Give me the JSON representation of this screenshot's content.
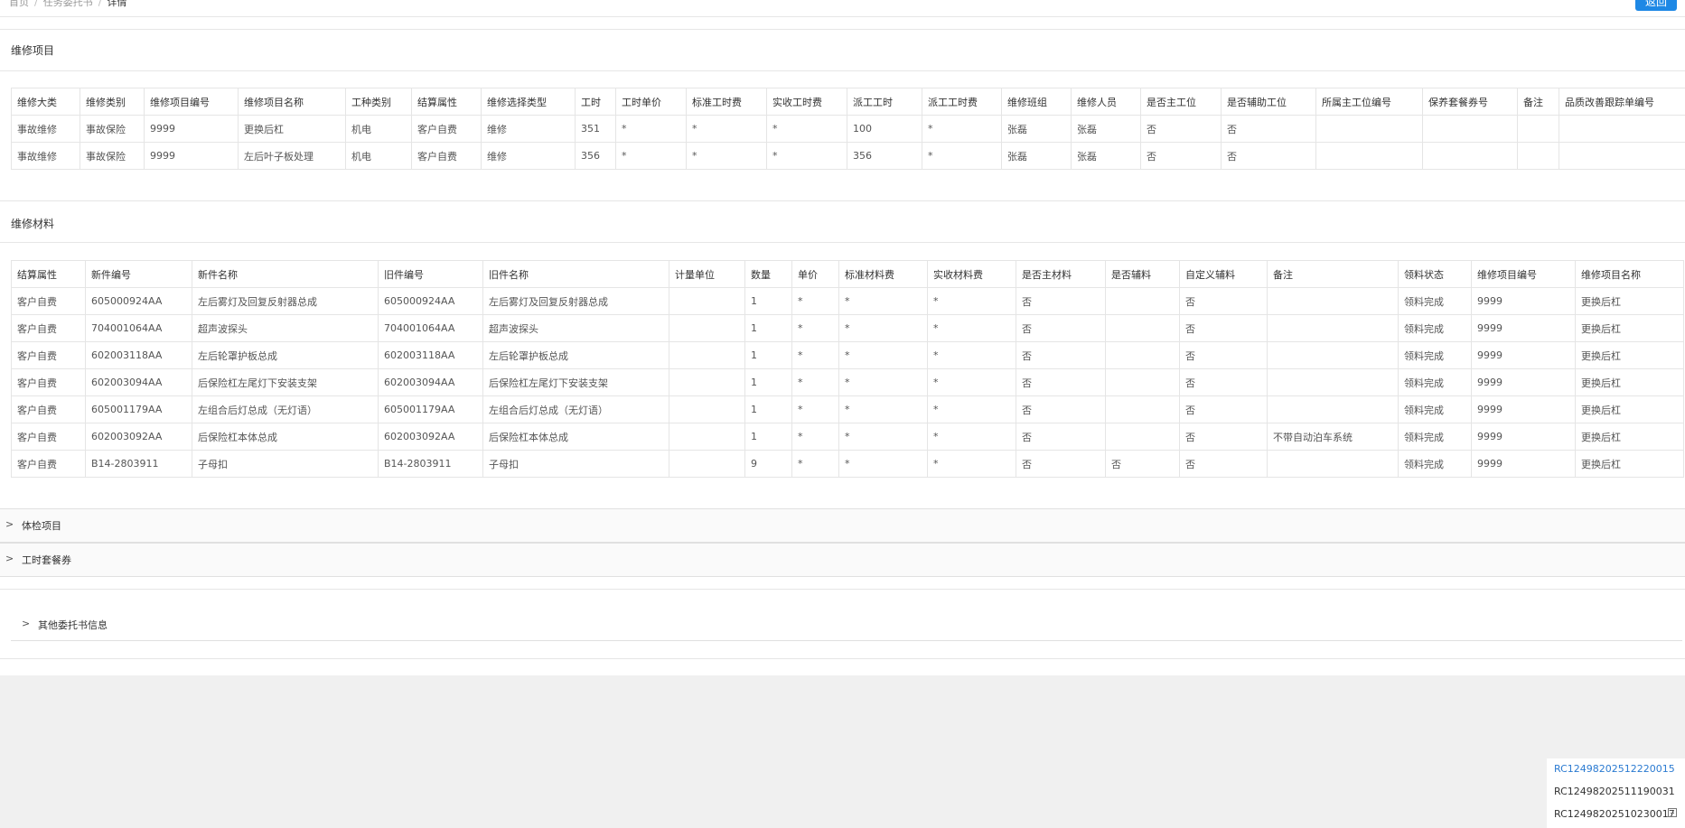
{
  "breadcrumb": {
    "items": [
      "首页",
      "任务委托书",
      "详情"
    ]
  },
  "header": {
    "back_label": "返回"
  },
  "repair_items": {
    "title": "维修项目",
    "columns": [
      "维修大类",
      "维修类别",
      "维修项目编号",
      "维修项目名称",
      "工种类别",
      "结算属性",
      "维修选择类型",
      "工时",
      "工时单价",
      "标准工时费",
      "实收工时费",
      "派工工时",
      "派工工时费",
      "维修班组",
      "维修人员",
      "是否主工位",
      "是否辅助工位",
      "所属主工位编号",
      "保养套餐券号",
      "备注",
      "品质改善跟踪单编号"
    ],
    "rows": [
      [
        "事故维修",
        "事故保险",
        "9999",
        "更换后杠",
        "机电",
        "客户自费",
        "维修",
        "351",
        "*",
        "*",
        "*",
        "100",
        "*",
        "张磊",
        "张磊",
        "否",
        "否",
        "",
        "",
        "",
        ""
      ],
      [
        "事故维修",
        "事故保险",
        "9999",
        "左后叶子板处理",
        "机电",
        "客户自费",
        "维修",
        "356",
        "*",
        "*",
        "*",
        "356",
        "*",
        "张磊",
        "张磊",
        "否",
        "否",
        "",
        "",
        "",
        ""
      ]
    ]
  },
  "repair_materials": {
    "title": "维修材料",
    "columns": [
      "结算属性",
      "新件编号",
      "新件名称",
      "旧件编号",
      "旧件名称",
      "计量单位",
      "数量",
      "单价",
      "标准材料费",
      "实收材料费",
      "是否主材料",
      "是否辅料",
      "自定义辅料",
      "备注",
      "领料状态",
      "维修项目编号",
      "维修项目名称"
    ],
    "rows": [
      [
        "客户自费",
        "605000924AA",
        "左后雾灯及回复反射器总成",
        "605000924AA",
        "左后雾灯及回复反射器总成",
        "",
        "1",
        "*",
        "*",
        "*",
        "否",
        "",
        "否",
        "",
        "领料完成",
        "9999",
        "更换后杠"
      ],
      [
        "客户自费",
        "704001064AA",
        "超声波探头",
        "704001064AA",
        "超声波探头",
        "",
        "1",
        "*",
        "*",
        "*",
        "否",
        "",
        "否",
        "",
        "领料完成",
        "9999",
        "更换后杠"
      ],
      [
        "客户自费",
        "602003118AA",
        "左后轮罩护板总成",
        "602003118AA",
        "左后轮罩护板总成",
        "",
        "1",
        "*",
        "*",
        "*",
        "否",
        "",
        "否",
        "",
        "领料完成",
        "9999",
        "更换后杠"
      ],
      [
        "客户自费",
        "602003094AA",
        "后保险杠左尾灯下安装支架",
        "602003094AA",
        "后保险杠左尾灯下安装支架",
        "",
        "1",
        "*",
        "*",
        "*",
        "否",
        "",
        "否",
        "",
        "领料完成",
        "9999",
        "更换后杠"
      ],
      [
        "客户自费",
        "605001179AA",
        "左组合后灯总成（无灯语）",
        "605001179AA",
        "左组合后灯总成（无灯语）",
        "",
        "1",
        "*",
        "*",
        "*",
        "否",
        "",
        "否",
        "",
        "领料完成",
        "9999",
        "更换后杠"
      ],
      [
        "客户自费",
        "602003092AA",
        "后保险杠本体总成",
        "602003092AA",
        "后保险杠本体总成",
        "",
        "1",
        "*",
        "*",
        "*",
        "否",
        "",
        "否",
        "不带自动泊车系统",
        "领料完成",
        "9999",
        "更换后杠"
      ],
      [
        "客户自费",
        "B14-2803911",
        "子母扣",
        "B14-2803911",
        "子母扣",
        "",
        "9",
        "*",
        "*",
        "*",
        "否",
        "否",
        "否",
        "",
        "领料完成",
        "9999",
        "更换后杠"
      ]
    ]
  },
  "collapsed_sections": [
    {
      "label": "体检项目",
      "icon": "chevron-right-icon"
    },
    {
      "label": "工时套餐券",
      "icon": "chevron-right-icon"
    }
  ],
  "other_info": {
    "label": "其他委托书信息",
    "icon": "chevron-right-icon"
  },
  "history": {
    "items": [
      "RC12498202512220015",
      "RC12498202511190031",
      "RC12498202510230017"
    ]
  },
  "colors": {
    "accent": "#1e88e5",
    "link": "#2a7ad1",
    "background": "#f0f0f0"
  }
}
